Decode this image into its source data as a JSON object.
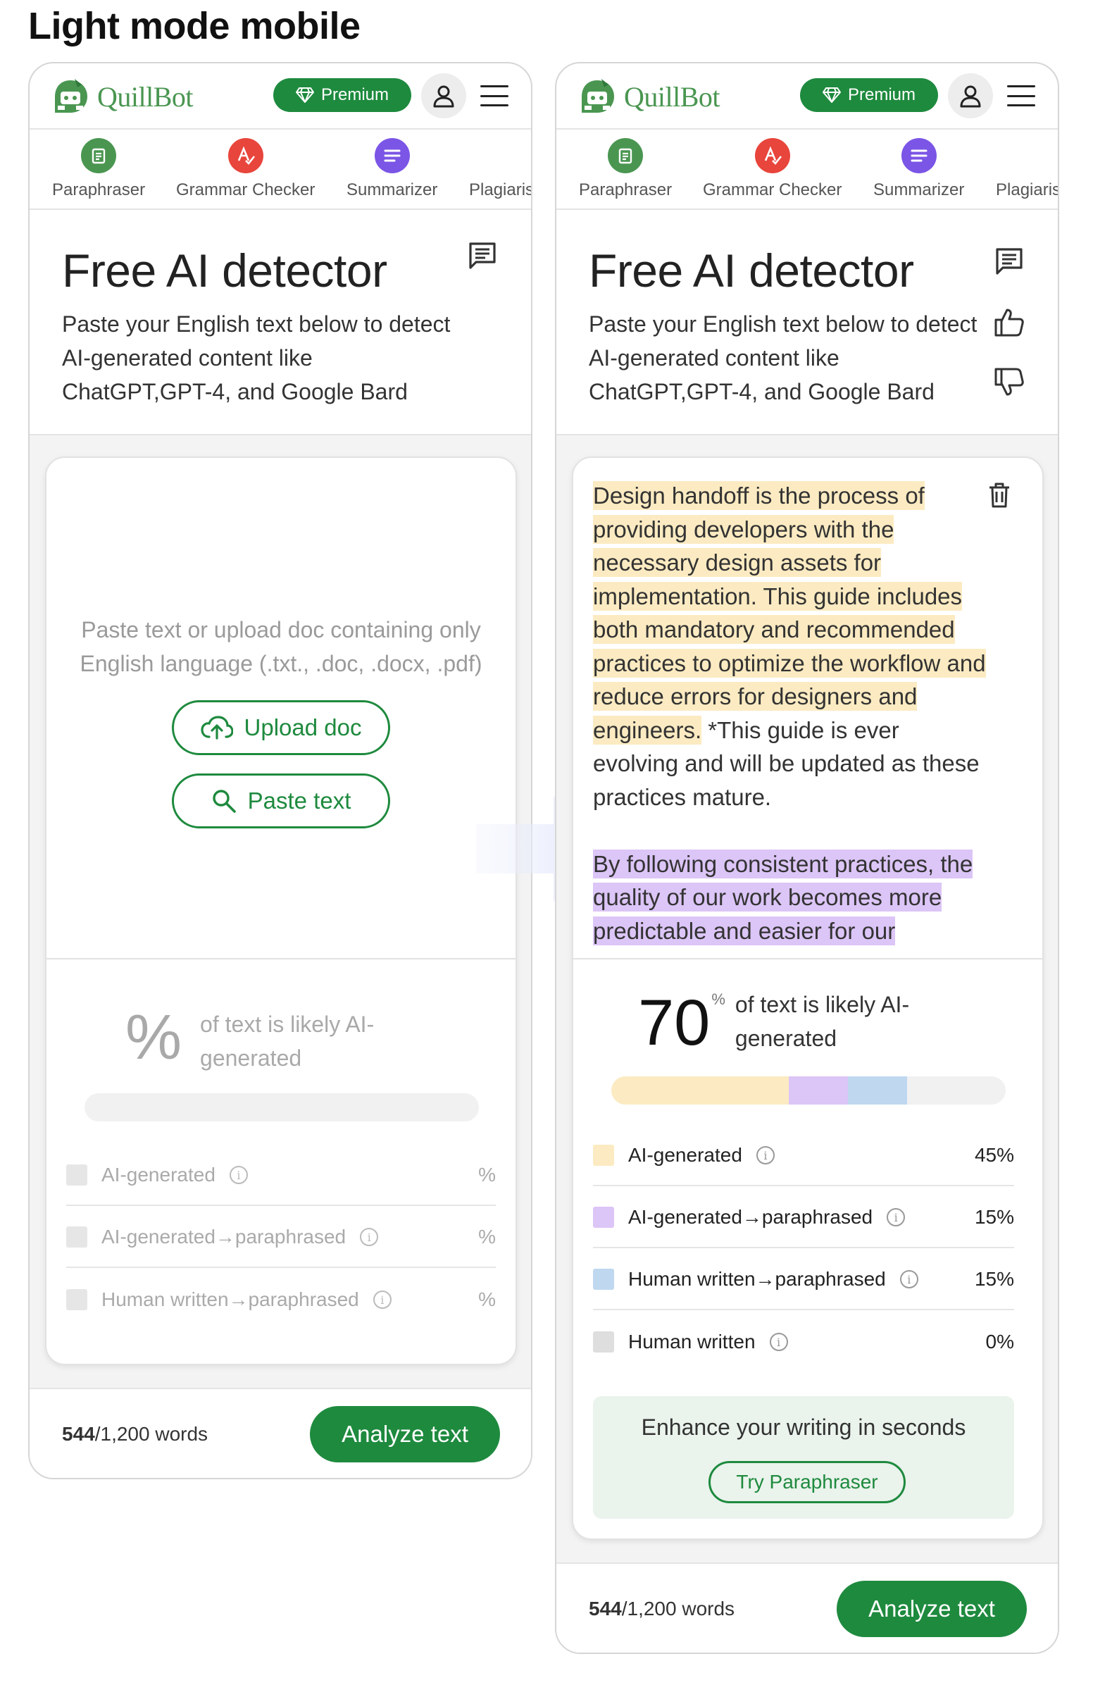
{
  "page_heading": "Light mode mobile",
  "brand": {
    "name": "QuillBot",
    "premium_label": "Premium",
    "primary_color": "#1e8a3e",
    "logo_color": "#4a9651"
  },
  "tools": [
    {
      "label": "Paraphraser",
      "icon": "paraphraser-icon",
      "color": "#4a9651"
    },
    {
      "label": "Grammar Checker",
      "icon": "grammar-checker-icon",
      "color": "#e8453c"
    },
    {
      "label": "Summarizer",
      "icon": "summarizer-icon",
      "color": "#7b55e6"
    },
    {
      "label": "Plagiarism Checker",
      "icon": "plagiarism-checker-icon",
      "color": "#f0a030"
    }
  ],
  "intro": {
    "title": "Free AI detector",
    "description": "Paste your English text below to detect AI-generated content like ChatGPT,GPT-4, and Google Bard"
  },
  "empty_state": {
    "placeholder": "Paste text or upload doc containing only English language (.txt., .doc, .docx, .pdf)",
    "upload_label": "Upload doc",
    "paste_label": "Paste text"
  },
  "results": {
    "empty_score": "%",
    "score_value": "70",
    "score_unit": "%",
    "score_caption": "of text is likely AI-generated",
    "rows": [
      {
        "label": "AI-generated",
        "value": "45%",
        "empty_value": "%",
        "color": "#fcebc2"
      },
      {
        "label": "AI-generated→paraphrased",
        "value": "15%",
        "empty_value": "%",
        "color": "#dcc5f7"
      },
      {
        "label": "Human written→paraphrased",
        "value": "15%",
        "empty_value": "%",
        "color": "#bfd8f0"
      },
      {
        "label": "Human written",
        "value": "0%",
        "color": "#dedede"
      }
    ],
    "bar_segments": [
      0.45,
      0.15,
      0.15,
      0.0
    ],
    "bar_empty_color": "#f1f1f1"
  },
  "document": {
    "para1_ai": "Design handoff is the process of providing developers with the necessary design assets for implementation. This guide includes both mandatory and recommended practices to optimize the workflow and reduce errors for designers and engineers.",
    "para1_human": "*This guide is ever evolving and will be updated as these practices mature.",
    "para2_paraphrased": "By following consistent practices, the quality of our work becomes more predictable and easier for our"
  },
  "promo": {
    "text": "Enhance your writing in seconds",
    "button_label": "Try Paraphraser"
  },
  "footer": {
    "words_current": "544",
    "words_total": "/1,200 words",
    "analyze_label": "Analyze text"
  }
}
